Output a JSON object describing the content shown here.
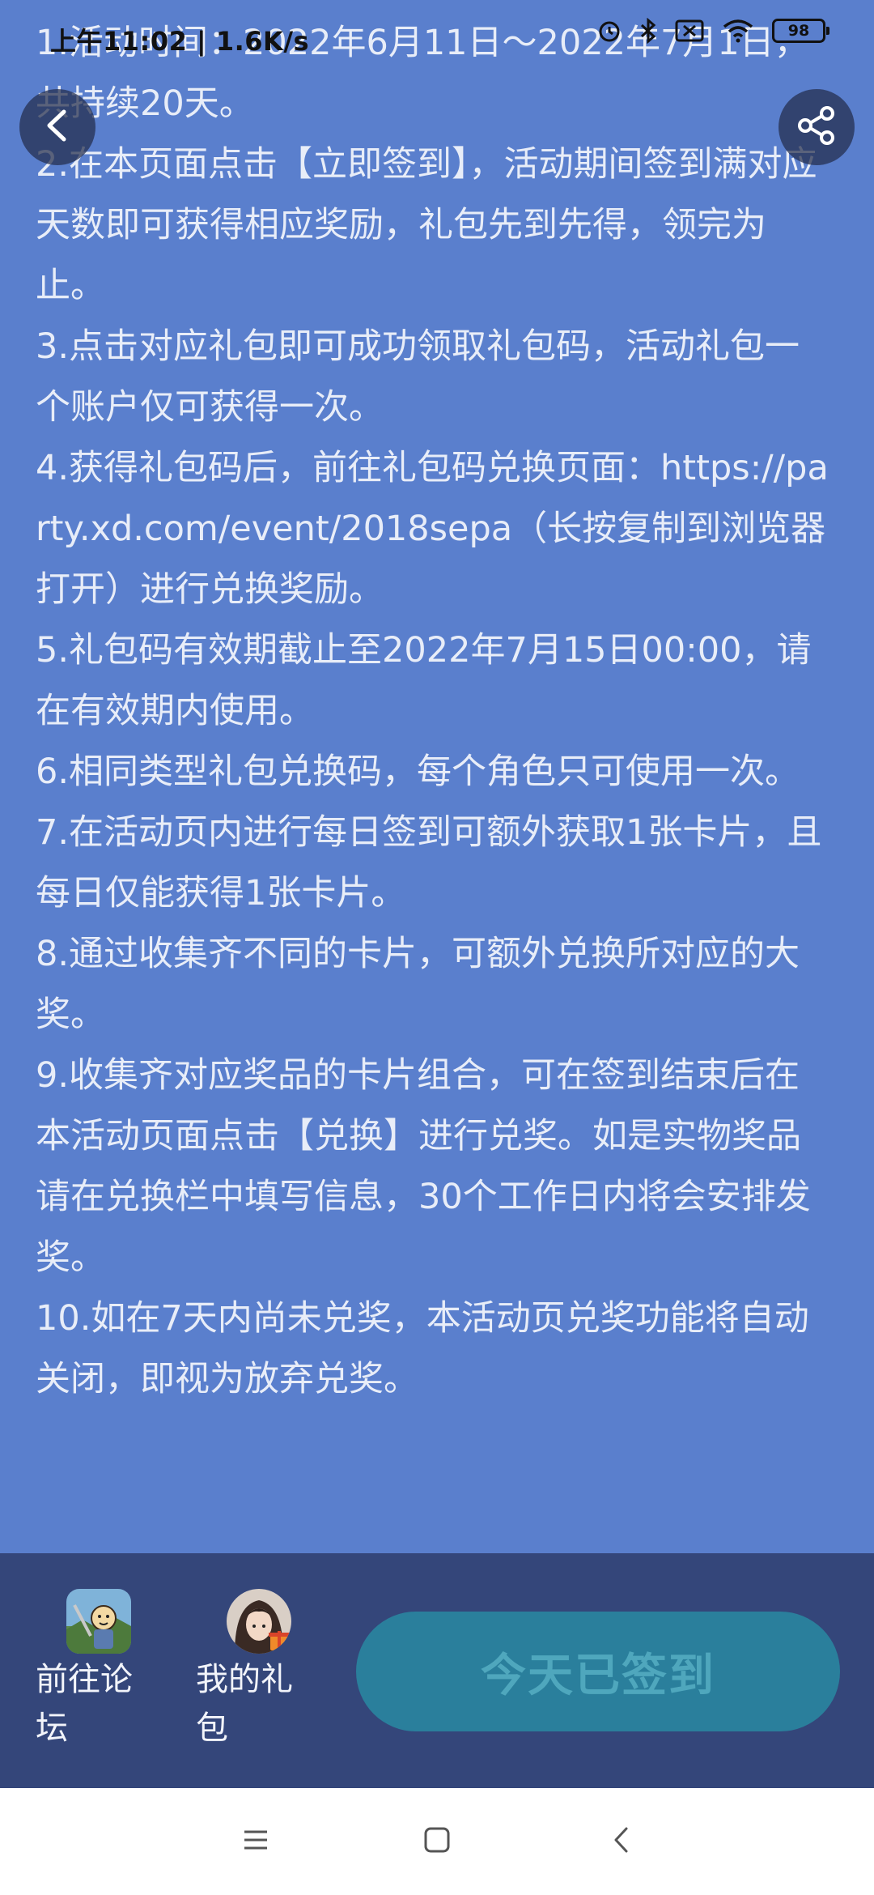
{
  "status_bar": {
    "time": "上午11:02 | 1.6K/s",
    "battery": "98",
    "icons": [
      "alarm-icon",
      "bluetooth-icon",
      "sim-icon",
      "wifi-icon",
      "battery-icon"
    ]
  },
  "header": {
    "back_icon": "chevron-left-icon",
    "share_icon": "share-icon"
  },
  "rules": [
    "1.活动时间：2022年6月11日～2022年7月1日，共持续20天。",
    "2.在本页面点击【立即签到】，活动期间签到满对应天数即可获得相应奖励，礼包先到先得，领完为止。",
    "3.点击对应礼包即可成功领取礼包码，活动礼包一个账户仅可获得一次。",
    "4.获得礼包码后，前往礼包码兑换页面：https://party.xd.com/event/2018sepa（长按复制到浏览器打开）进行兑换奖励。",
    "5.礼包码有效期截止至2022年7月15日00:00，请在有效期内使用。",
    "6.相同类型礼包兑换码，每个角色只可使用一次。",
    "7.在活动页内进行每日签到可额外获取1张卡片，且每日仅能获得1张卡片。",
    "8.通过收集齐不同的卡片，可额外兑换所对应的大奖。",
    "9.收集齐对应奖品的卡片组合，可在签到结束后在本活动页面点击【兑换】进行兑奖。如是实物奖品请在兑换栏中填写信息，30个工作日内将会安排发奖。",
    "10.如在7天内尚未兑奖，本活动页兑奖功能将自动关闭，即视为放弃兑奖。"
  ],
  "actions": {
    "forum_label": "前往论坛",
    "gifts_label": "我的礼包",
    "signin_label": "今天已签到"
  },
  "colors": {
    "page_bg": "#5a7fcd",
    "action_bar_bg": "#34467a",
    "signin_bg": "#2a7f9c",
    "signin_text": "#4fa7bd"
  },
  "nav": {
    "icons": [
      "menu-icon",
      "home-icon",
      "back-icon"
    ]
  }
}
